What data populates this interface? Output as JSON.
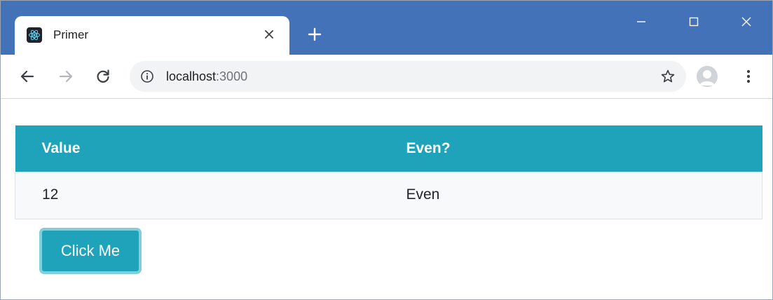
{
  "browser": {
    "tab": {
      "title": "Primer",
      "favicon": "react-logo-icon",
      "close_icon": "close-icon"
    },
    "new_tab_icon": "plus-icon",
    "window_controls": [
      "minimize-icon",
      "maximize-icon",
      "close-icon"
    ],
    "toolbar": {
      "back_icon": "arrow-left-icon",
      "forward_icon": "arrow-right-icon",
      "reload_icon": "reload-icon",
      "url_host": "localhost",
      "url_port": ":3000",
      "site_info_icon": "info-icon",
      "bookmark_icon": "star-icon",
      "profile_icon": "avatar-icon",
      "menu_icon": "kebab-menu-icon"
    },
    "colors": {
      "title_bar": "#4472b8",
      "accent": "#1fa3ba",
      "button_focus_ring": "#7fd0dc"
    }
  },
  "page": {
    "table": {
      "headers": [
        "Value",
        "Even?"
      ],
      "rows": [
        [
          "12",
          "Even"
        ]
      ]
    },
    "button_label": "Click Me"
  }
}
